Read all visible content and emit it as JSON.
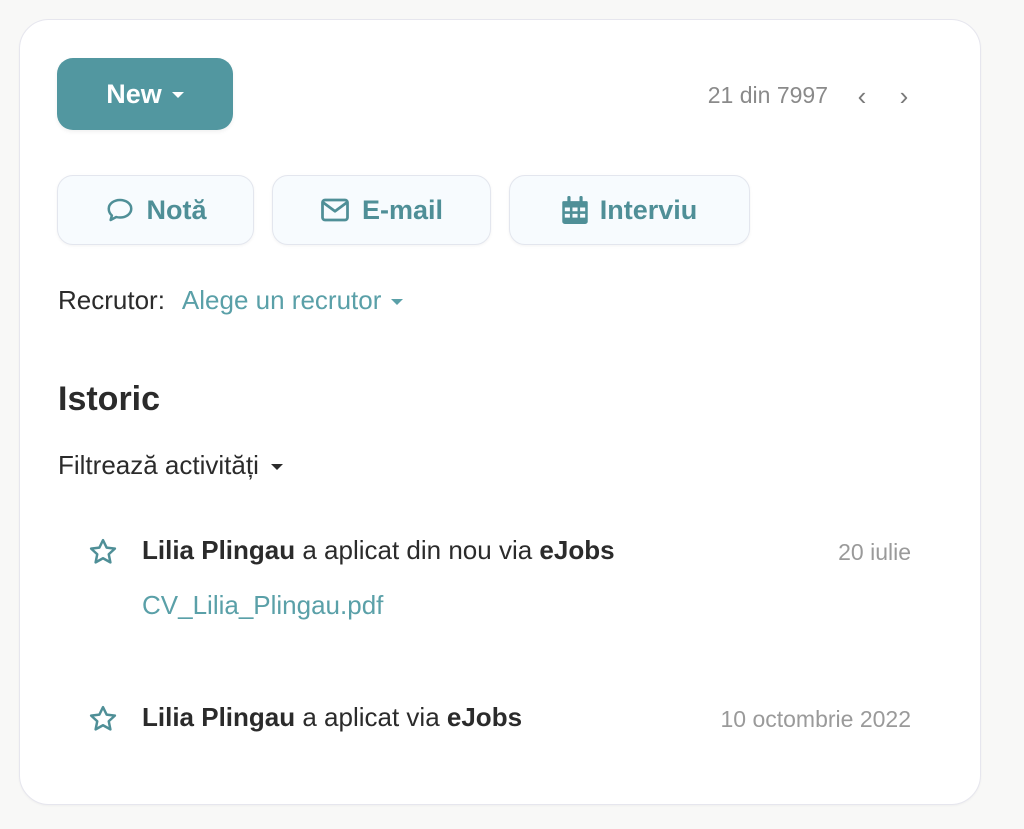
{
  "header": {
    "new_button": "New",
    "pager": {
      "text": "21 din 7997",
      "prev_icon": "chevron-left-icon",
      "next_icon": "chevron-right-icon"
    }
  },
  "actions": [
    {
      "label": "Notă",
      "icon": "comment-icon"
    },
    {
      "label": "E-mail",
      "icon": "envelope-icon"
    },
    {
      "label": "Interviu",
      "icon": "calendar-icon"
    }
  ],
  "recruiter": {
    "label": "Recrutor:",
    "placeholder": "Alege un recrutor"
  },
  "history": {
    "title": "Istoric",
    "filter_label": "Filtrează activități",
    "entries": [
      {
        "name": "Lilia Plingau",
        "action": " a aplicat din nou via ",
        "source": "eJobs",
        "date": "20 iulie",
        "attachment": "CV_Lilia_Plingau.pdf"
      },
      {
        "name": "Lilia Plingau",
        "action": " a aplicat via ",
        "source": "eJobs",
        "date": "10 octombrie 2022"
      }
    ]
  },
  "colors": {
    "accent": "#5297a0",
    "link": "#5aa0a8",
    "page_bg": "#f8f8f7",
    "muted": "#9a9a9a"
  }
}
